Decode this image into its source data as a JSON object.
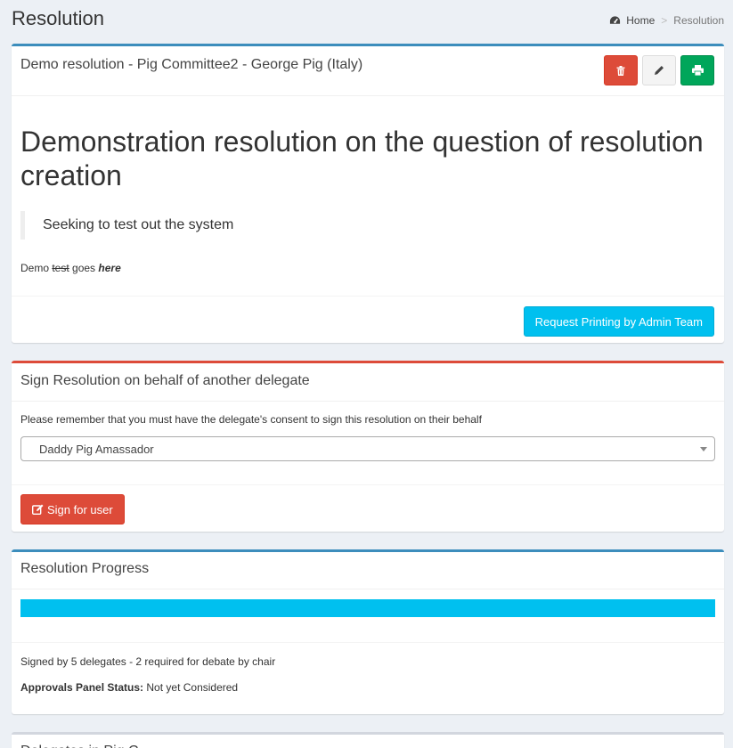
{
  "page": {
    "title": "Resolution",
    "breadcrumb": {
      "home": "Home",
      "separator": ">",
      "current": "Resolution"
    }
  },
  "resolution_box": {
    "header": "Demo resolution - Pig Committee2 - George Pig (Italy)",
    "title": "Demonstration resolution on the question of resolution creation",
    "quote": "Seeking to test out the system",
    "body": {
      "part1": "Demo ",
      "strike": "test",
      "part2": " goes ",
      "italic": "here"
    },
    "print_button": "Request Printing by Admin Team",
    "tool_icons": [
      "trash-icon",
      "pencil-icon",
      "print-icon"
    ]
  },
  "sign_box": {
    "header": "Sign Resolution on behalf of another delegate",
    "notice": "Please remember that you must have the delegate's consent to sign this resolution on their behalf",
    "selected_delegate": "Daddy Pig Amassador",
    "sign_button": "Sign for user"
  },
  "progress_box": {
    "header": "Resolution Progress",
    "progress_fraction": 1.0,
    "signed_text": "Signed by 5 delegates - 2 required for debate by chair",
    "status_label": "Approvals Panel Status:",
    "status_value": " Not yet Considered"
  },
  "next_box": {
    "header": "Delegates in Pig C"
  },
  "colors": {
    "primary": "#3c8dbc",
    "danger": "#dd4b39",
    "success": "#00a65a",
    "info": "#00c0ef",
    "background": "#ecf0f5"
  }
}
